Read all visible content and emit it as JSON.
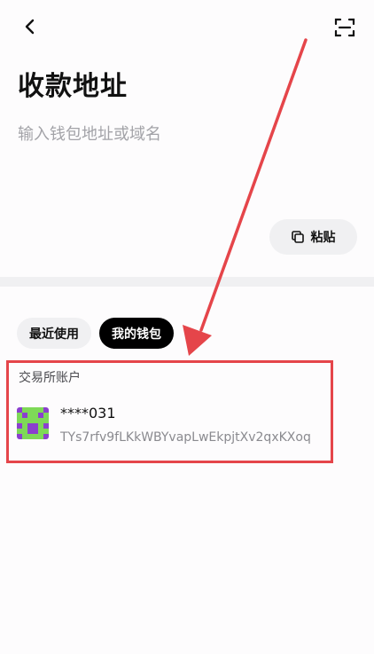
{
  "header": {
    "back_icon": "chevron-left-icon",
    "scan_icon": "scan-icon"
  },
  "page": {
    "title": "收款地址"
  },
  "address_input": {
    "placeholder": "输入钱包地址或域名",
    "value": ""
  },
  "paste_button": {
    "label": "粘贴",
    "icon": "copy-icon"
  },
  "tabs": [
    {
      "label": "最近使用",
      "active": false
    },
    {
      "label": "我的钱包",
      "active": true
    }
  ],
  "section": {
    "label": "交易所账户"
  },
  "accounts": [
    {
      "name": "****031",
      "address": "TYs7rfv9fLKkWBYvapLwEkpjtXv2qxKXoq",
      "avatar_colors": [
        "#8b3fcf",
        "#7ed957"
      ]
    }
  ],
  "colors": {
    "annotation": "#e5454a",
    "active_tab_bg": "#000000",
    "inactive_tab_bg": "#f0f0f2"
  }
}
